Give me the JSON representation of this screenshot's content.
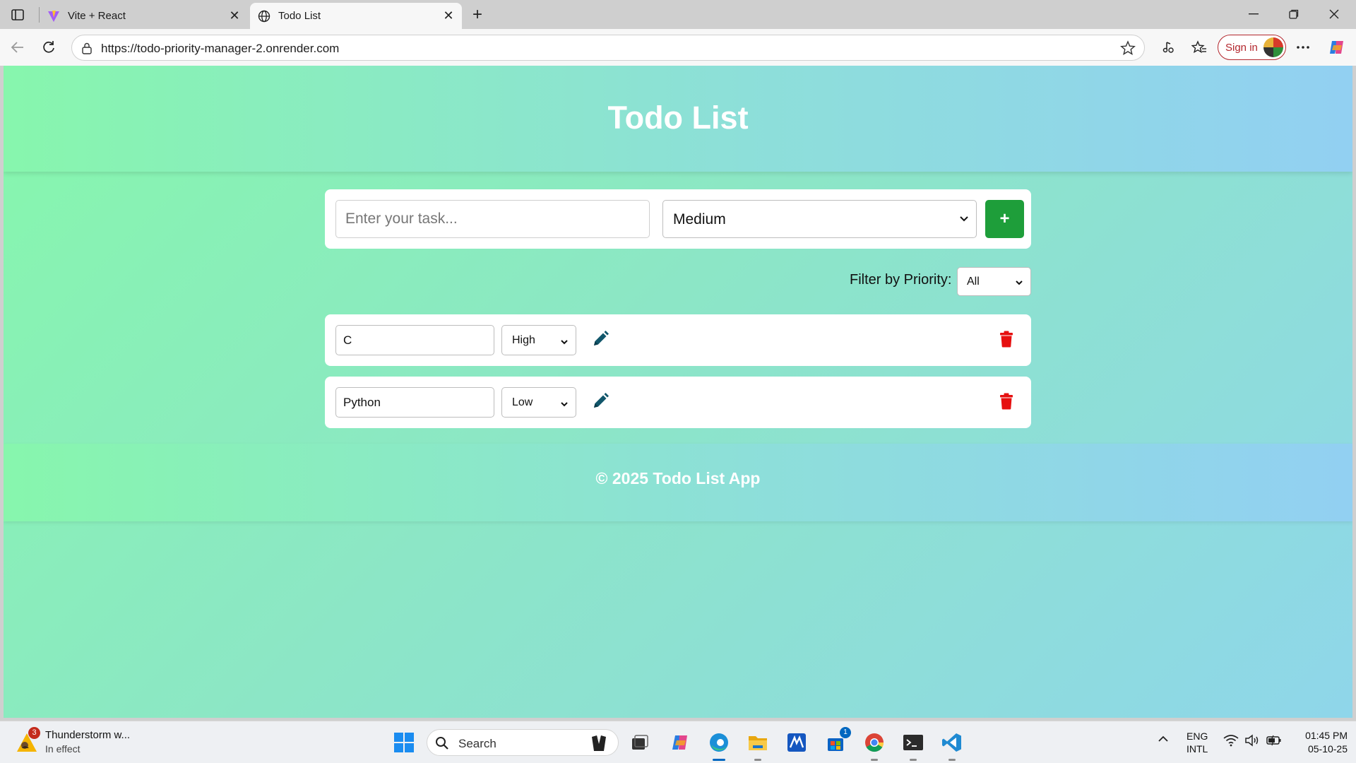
{
  "browser": {
    "tabs": [
      {
        "title": "Vite + React",
        "icon": "vite-icon",
        "active": false
      },
      {
        "title": "Todo List",
        "icon": "globe-icon",
        "active": true
      }
    ],
    "url": "https://todo-priority-manager-2.onrender.com",
    "sign_in_label": "Sign in"
  },
  "app": {
    "title": "Todo List",
    "new_task": {
      "placeholder": "Enter your task...",
      "value": ""
    },
    "priority_select": {
      "selected": "Medium"
    },
    "add_button_label": "+",
    "filter": {
      "label": "Filter by Priority:",
      "selected": "All"
    },
    "todos": [
      {
        "text": "C",
        "priority": "High"
      },
      {
        "text": "Python",
        "priority": "Low"
      }
    ],
    "footer": "© 2025 Todo List App"
  },
  "taskbar": {
    "weather": {
      "title": "Thunderstorm w...",
      "status": "In effect",
      "badge": "3"
    },
    "search_label": "Search",
    "store_badge": "1",
    "lang_line1": "ENG",
    "lang_line2": "INTL",
    "time": "01:45 PM",
    "date": "05-10-25"
  },
  "colors": {
    "accent_green": "#1e9e3a",
    "delete_red": "#e61010",
    "edit_teal": "#11566b",
    "bg_gradient_start": "#86f7ac",
    "bg_gradient_end": "#8fd6ea"
  }
}
